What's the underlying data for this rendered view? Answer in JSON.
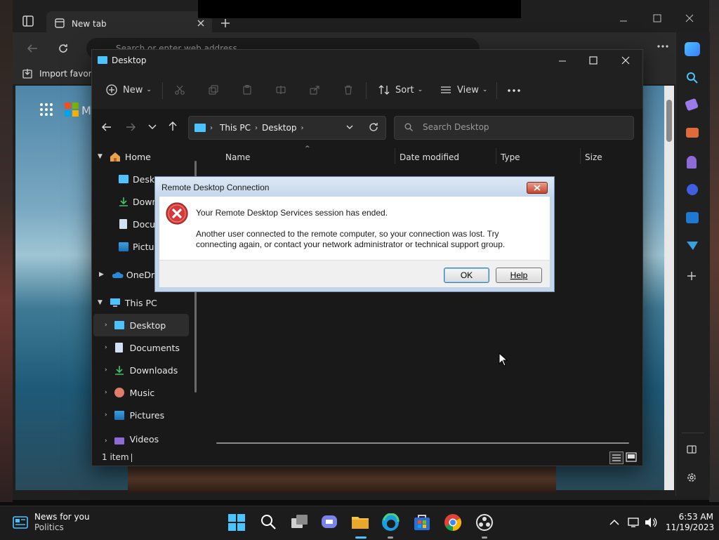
{
  "browser": {
    "tab_title": "New tab",
    "address_placeholder": "Search or enter web address",
    "favorites_label": "Import favorites",
    "page_brand_fragment": "M"
  },
  "explorer": {
    "window_title": "Desktop",
    "toolbar": {
      "new_label": "New",
      "sort_label": "Sort",
      "view_label": "View"
    },
    "breadcrumb": [
      "This PC",
      "Desktop"
    ],
    "search_placeholder": "Search Desktop",
    "columns": [
      "Name",
      "Date modified",
      "Type",
      "Size"
    ],
    "nav": {
      "home": "Home",
      "home_children": [
        "Deskt",
        "Down",
        "Docu",
        "Pictur"
      ],
      "onedrive": "OneDri",
      "this_pc": "This PC",
      "pc_children": [
        "Desktop",
        "Documents",
        "Downloads",
        "Music",
        "Pictures",
        "Videos"
      ]
    },
    "status_text": "1 item"
  },
  "dialog": {
    "title": "Remote Desktop Connection",
    "heading": "Your Remote Desktop Services session has ended.",
    "message_line1": "Another user connected to the remote computer, so your connection was lost. Try",
    "message_line2": "connecting again, or contact your network administrator or technical support group.",
    "ok_label": "OK",
    "help_label": "Help"
  },
  "taskbar": {
    "news_title": "News for you",
    "news_subtitle": "Politics",
    "time": "6:53 AM",
    "date": "11/19/2023"
  },
  "colors": {
    "accent_blue": "#4cc2ff",
    "error_red": "#d33b3b",
    "folder_yellow": "#f4c542"
  }
}
